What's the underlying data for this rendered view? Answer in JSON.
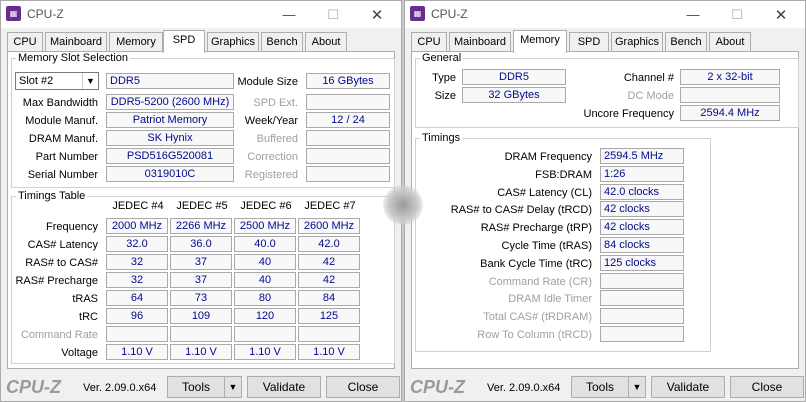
{
  "left": {
    "title": "CPU-Z",
    "tabs": [
      "CPU",
      "Mainboard",
      "Memory",
      "SPD",
      "Graphics",
      "Bench",
      "About"
    ],
    "active_tab": "SPD",
    "slot_group": "Memory Slot Selection",
    "slot_select": "Slot #2",
    "slot_type": "DDR5",
    "labels": {
      "module_size": "Module Size",
      "max_bandwidth": "Max Bandwidth",
      "spd_ext": "SPD Ext.",
      "module_manuf": "Module Manuf.",
      "week_year": "Week/Year",
      "dram_manuf": "DRAM Manuf.",
      "buffered": "Buffered",
      "part_number": "Part Number",
      "correction": "Correction",
      "serial_number": "Serial Number",
      "registered": "Registered"
    },
    "values": {
      "module_size": "16 GBytes",
      "max_bandwidth": "DDR5-5200 (2600 MHz)",
      "spd_ext": "",
      "module_manuf": "Patriot Memory",
      "week_year": "12 / 24",
      "dram_manuf": "SK Hynix",
      "buffered": "",
      "part_number": "PSD516G520081",
      "correction": "",
      "serial_number": "0319010C",
      "registered": ""
    },
    "timings_group": "Timings Table",
    "timings_headers": [
      "JEDEC #4",
      "JEDEC #5",
      "JEDEC #6",
      "JEDEC #7"
    ],
    "timings_rows": [
      {
        "label": "Frequency",
        "values": [
          "2000 MHz",
          "2266 MHz",
          "2500 MHz",
          "2600 MHz"
        ],
        "disabled": false
      },
      {
        "label": "CAS# Latency",
        "values": [
          "32.0",
          "36.0",
          "40.0",
          "42.0"
        ],
        "disabled": false
      },
      {
        "label": "RAS# to CAS#",
        "values": [
          "32",
          "37",
          "40",
          "42"
        ],
        "disabled": false
      },
      {
        "label": "RAS# Precharge",
        "values": [
          "32",
          "37",
          "40",
          "42"
        ],
        "disabled": false
      },
      {
        "label": "tRAS",
        "values": [
          "64",
          "73",
          "80",
          "84"
        ],
        "disabled": false
      },
      {
        "label": "tRC",
        "values": [
          "96",
          "109",
          "120",
          "125"
        ],
        "disabled": false
      },
      {
        "label": "Command Rate",
        "values": [
          "",
          "",
          "",
          ""
        ],
        "disabled": true
      },
      {
        "label": "Voltage",
        "values": [
          "1.10 V",
          "1.10 V",
          "1.10 V",
          "1.10 V"
        ],
        "disabled": false
      }
    ],
    "footer": {
      "logo": "CPU-Z",
      "version": "Ver. 2.09.0.x64",
      "tools": "Tools",
      "validate": "Validate",
      "close": "Close"
    }
  },
  "right": {
    "title": "CPU-Z",
    "tabs": [
      "CPU",
      "Mainboard",
      "Memory",
      "SPD",
      "Graphics",
      "Bench",
      "About"
    ],
    "active_tab": "Memory",
    "general_group": "General",
    "labels": {
      "type": "Type",
      "channel": "Channel #",
      "size": "Size",
      "dc_mode": "DC Mode",
      "uncore_freq": "Uncore Frequency"
    },
    "values": {
      "type": "DDR5",
      "channel": "2 x 32-bit",
      "size": "32 GBytes",
      "dc_mode": "",
      "uncore_freq": "2594.4 MHz"
    },
    "timings_group": "Timings",
    "timings": [
      {
        "label": "DRAM Frequency",
        "value": "2594.5 MHz",
        "disabled": false
      },
      {
        "label": "FSB:DRAM",
        "value": "1:26",
        "disabled": false
      },
      {
        "label": "CAS# Latency (CL)",
        "value": "42.0 clocks",
        "disabled": false
      },
      {
        "label": "RAS# to CAS# Delay (tRCD)",
        "value": "42 clocks",
        "disabled": false
      },
      {
        "label": "RAS# Precharge (tRP)",
        "value": "42 clocks",
        "disabled": false
      },
      {
        "label": "Cycle Time (tRAS)",
        "value": "84 clocks",
        "disabled": false
      },
      {
        "label": "Bank Cycle Time (tRC)",
        "value": "125 clocks",
        "disabled": false
      },
      {
        "label": "Command Rate (CR)",
        "value": "",
        "disabled": true
      },
      {
        "label": "DRAM Idle Timer",
        "value": "",
        "disabled": true
      },
      {
        "label": "Total CAS# (tRDRAM)",
        "value": "",
        "disabled": true
      },
      {
        "label": "Row To Column (tRCD)",
        "value": "",
        "disabled": true
      }
    ],
    "footer": {
      "logo": "CPU-Z",
      "version": "Ver. 2.09.0.x64",
      "tools": "Tools",
      "validate": "Validate",
      "close": "Close"
    }
  }
}
